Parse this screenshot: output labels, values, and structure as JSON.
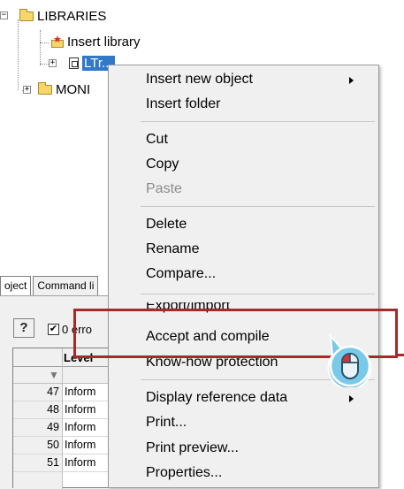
{
  "tree": {
    "libraries_label": "LIBRARIES",
    "insert_library_label": "Insert library",
    "selected_label": "LTr...",
    "monitor_label": "MONI"
  },
  "lower_window": {
    "tabs": [
      "oject",
      "Command li"
    ],
    "help_symbol": "?",
    "check_mark": "✔",
    "errors_label": "0 erro",
    "level_header": "Level",
    "rows": [
      {
        "num": "47",
        "text": "Inform"
      },
      {
        "num": "48",
        "text": "Inform"
      },
      {
        "num": "49",
        "text": "Inform"
      },
      {
        "num": "50",
        "text": "Inform"
      },
      {
        "num": "51",
        "text": "Inform"
      }
    ]
  },
  "context_menu": {
    "items": [
      {
        "label": "Insert new object",
        "submenu": true
      },
      {
        "label": "Insert folder"
      },
      {
        "label": "Cut"
      },
      {
        "label": "Copy"
      },
      {
        "label": "Paste",
        "disabled": true
      },
      {
        "label": "Delete"
      },
      {
        "label": "Rename"
      },
      {
        "label": "Compare..."
      },
      {
        "label": "Export/import"
      },
      {
        "label": "Accept and compile"
      },
      {
        "label": "Know-how protection"
      },
      {
        "label": "Display reference data",
        "submenu": true
      },
      {
        "label": "Print..."
      },
      {
        "label": "Print preview..."
      },
      {
        "label": "Properties..."
      }
    ]
  },
  "colors": {
    "highlight_border": "#a52a2a",
    "selection": "#3178c6",
    "bubble_fill": "#79c9e8"
  },
  "icons": [
    "folder-icon",
    "insert-library-icon",
    "library-icon",
    "mouse-click-icon",
    "help-icon",
    "filter-icon",
    "submenu-arrow-icon"
  ]
}
